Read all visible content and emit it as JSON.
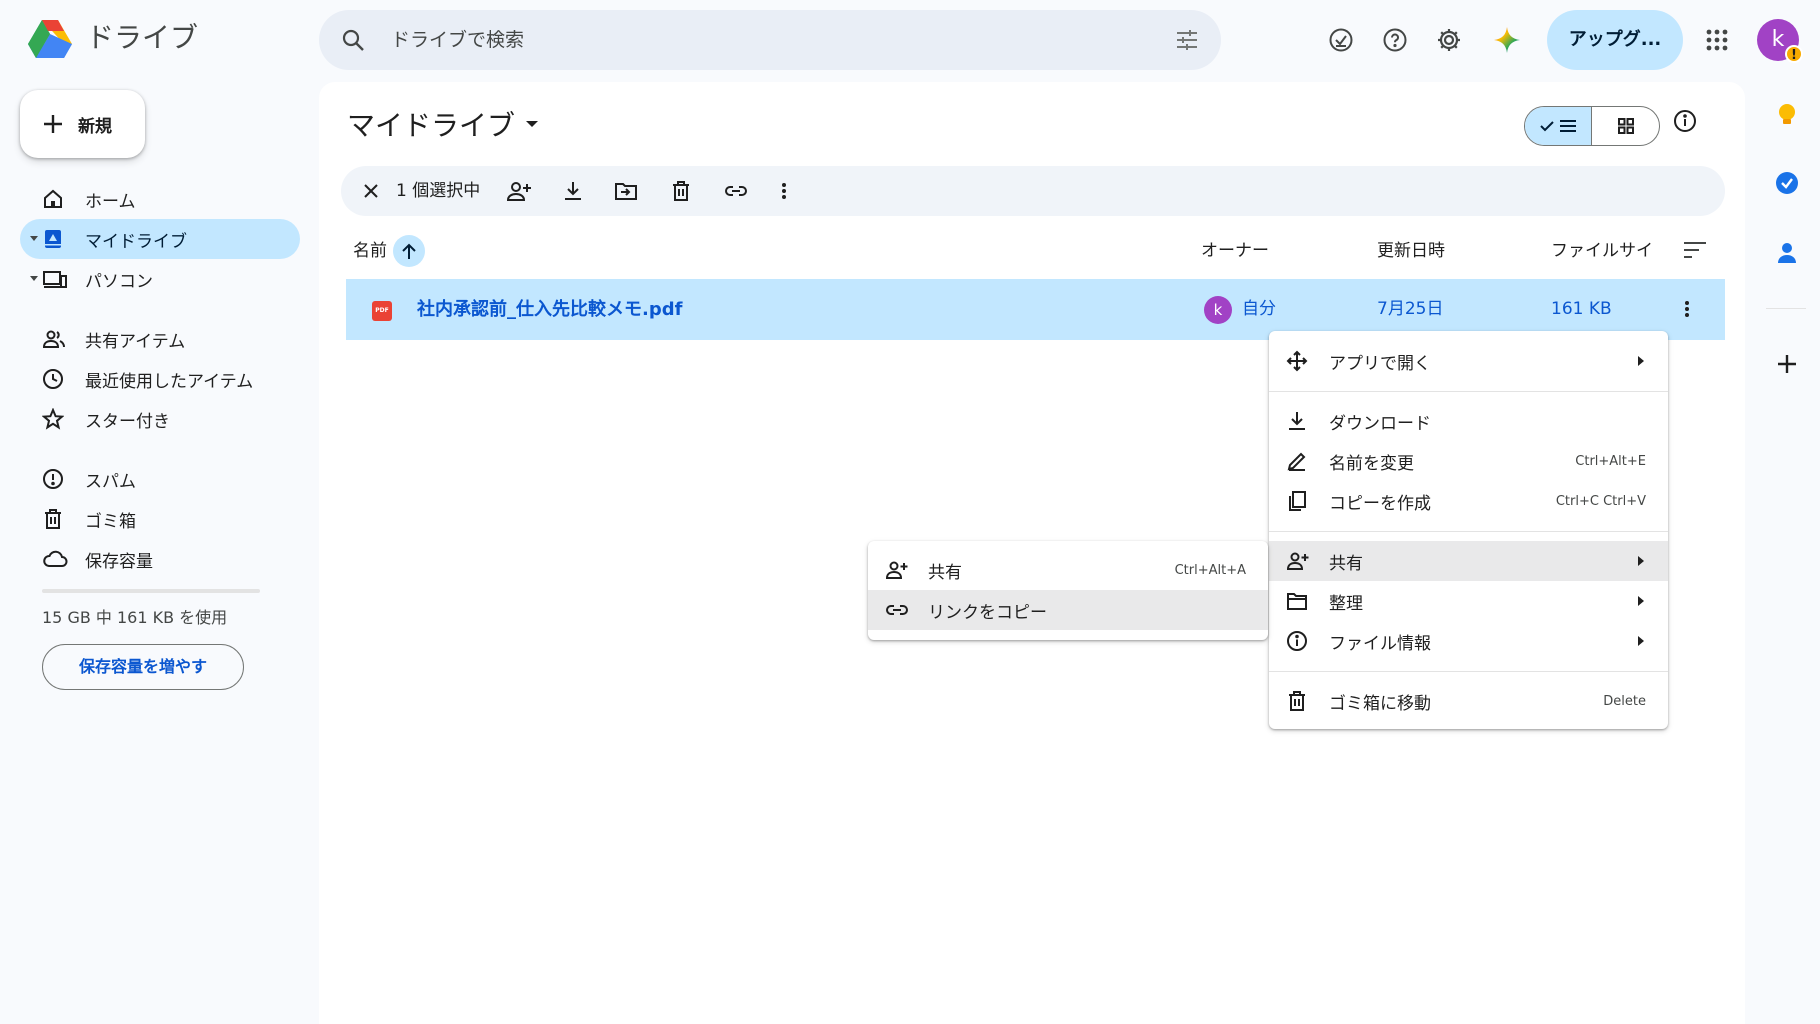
{
  "app": {
    "brand": "ドライブ"
  },
  "search": {
    "placeholder": "ドライブで検索"
  },
  "topbar": {
    "upgrade_label": "アップグ...",
    "avatar_letter": "k",
    "avatar_warning": "!"
  },
  "sidebar": {
    "new_label": "新規",
    "items": [
      {
        "label": "ホーム"
      },
      {
        "label": "マイドライブ"
      },
      {
        "label": "パソコン"
      },
      {
        "label": "共有アイテム"
      },
      {
        "label": "最近使用したアイテム"
      },
      {
        "label": "スター付き"
      },
      {
        "label": "スパム"
      },
      {
        "label": "ゴミ箱"
      },
      {
        "label": "保存容量"
      }
    ],
    "storage_text": "15 GB 中 161 KB を使用",
    "storage_button": "保存容量を増やす"
  },
  "main": {
    "title": "マイドライブ",
    "selection_count": "1 個選択中",
    "columns": {
      "name": "名前",
      "owner": "オーナー",
      "modified": "更新日時",
      "size": "ファイルサイ"
    },
    "file": {
      "icon_label": "PDF",
      "name": "社内承認前_仕入先比較メモ.pdf",
      "owner_letter": "k",
      "owner": "自分",
      "modified": "7月25日",
      "size": "161 KB"
    }
  },
  "context_menu": {
    "items": [
      {
        "label": "アプリで開く",
        "shortcut": ""
      },
      {
        "label": "ダウンロード",
        "shortcut": ""
      },
      {
        "label": "名前を変更",
        "shortcut": "Ctrl+Alt+E"
      },
      {
        "label": "コピーを作成",
        "shortcut": "Ctrl+C Ctrl+V"
      },
      {
        "label": "共有",
        "shortcut": ""
      },
      {
        "label": "整理",
        "shortcut": ""
      },
      {
        "label": "ファイル情報",
        "shortcut": ""
      },
      {
        "label": "ゴミ箱に移動",
        "shortcut": "Delete"
      }
    ]
  },
  "share_submenu": {
    "items": [
      {
        "label": "共有",
        "shortcut": "Ctrl+Alt+A"
      },
      {
        "label": "リンクをコピー",
        "shortcut": ""
      }
    ]
  },
  "colors": {
    "accent": "#0b57d0",
    "selection": "#c2e7ff",
    "background": "#f8fafd"
  }
}
